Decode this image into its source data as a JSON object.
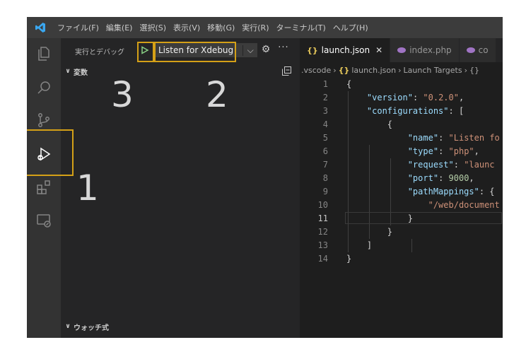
{
  "menubar": {
    "items": [
      "ファイル(F)",
      "編集(E)",
      "選択(S)",
      "表示(V)",
      "移動(G)",
      "実行(R)",
      "ターミナル(T)",
      "ヘルプ(H)"
    ]
  },
  "activitybar": {
    "icons": [
      "explorer-icon",
      "search-icon",
      "source-control-icon",
      "run-debug-icon",
      "extensions-icon",
      "remote-explorer-icon"
    ]
  },
  "sidebar": {
    "title": "実行とデバッグ",
    "config": "Listen for Xdebug",
    "more": "···",
    "variables_label": "変数",
    "watch_label": "ウォッチ式"
  },
  "annotations": {
    "one": "1",
    "two": "2",
    "three": "3"
  },
  "tabs": [
    {
      "icon": "{}",
      "label": "launch.json",
      "close": "✕",
      "active": true
    },
    {
      "icon": "php",
      "label": "index.php",
      "active": false
    },
    {
      "icon": "php",
      "label": "co",
      "active": false
    }
  ],
  "breadcrumb": {
    "folder": ".vscode",
    "file": "launch.json",
    "section": "Launch Targets",
    "item": "{}"
  },
  "code": {
    "lines": [
      "1",
      "2",
      "3",
      "4",
      "5",
      "6",
      "7",
      "8",
      "9",
      "10",
      "11",
      "12",
      "13",
      "14"
    ],
    "version_key": "\"version\"",
    "version_val": "\"0.2.0\"",
    "configs_key": "\"configurations\"",
    "name_key": "\"name\"",
    "name_val": "\"Listen fo",
    "type_key": "\"type\"",
    "type_val": "\"php\"",
    "request_key": "\"request\"",
    "request_val": "\"launc",
    "port_key": "\"port\"",
    "port_val": "9000",
    "pm_key": "\"pathMappings\"",
    "pm_val": "\"/web/document"
  },
  "colors": {
    "highlight": "#d4a017",
    "play": "#89d185",
    "accent": "#0078d4"
  }
}
